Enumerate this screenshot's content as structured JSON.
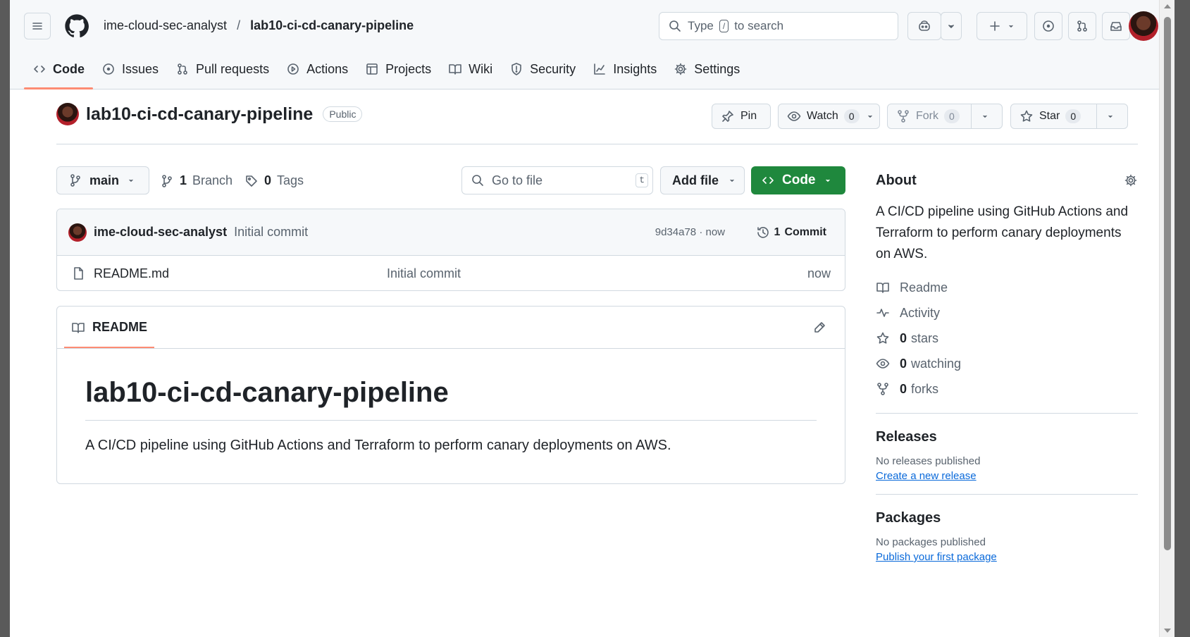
{
  "header": {
    "owner": "ime-cloud-sec-analyst",
    "separator": "/",
    "repo": "lab10-ci-cd-canary-pipeline",
    "search_text_before": "Type",
    "search_key": "/",
    "search_text_after": "to search"
  },
  "tabs": [
    {
      "label": "Code",
      "icon": "code-icon"
    },
    {
      "label": "Issues",
      "icon": "issue-icon"
    },
    {
      "label": "Pull requests",
      "icon": "pull-request-icon"
    },
    {
      "label": "Actions",
      "icon": "play-icon"
    },
    {
      "label": "Projects",
      "icon": "table-icon"
    },
    {
      "label": "Wiki",
      "icon": "book-icon"
    },
    {
      "label": "Security",
      "icon": "shield-icon"
    },
    {
      "label": "Insights",
      "icon": "graph-icon"
    },
    {
      "label": "Settings",
      "icon": "gear-icon"
    }
  ],
  "repo_head": {
    "name": "lab10-ci-cd-canary-pipeline",
    "visibility": "Public",
    "pin_label": "Pin",
    "watch_label": "Watch",
    "watch_count": "0",
    "fork_label": "Fork",
    "fork_count": "0",
    "star_label": "Star",
    "star_count": "0"
  },
  "file_nav": {
    "branch": "main",
    "branches_count": "1",
    "branches_label": "Branch",
    "tags_count": "0",
    "tags_label": "Tags",
    "goto_placeholder": "Go to file",
    "goto_key": "t",
    "add_file_label": "Add file",
    "code_label": "Code"
  },
  "latest_commit": {
    "author": "ime-cloud-sec-analyst",
    "message": "Initial commit",
    "sha_time": "9d34a78 · now",
    "commits_count": "1",
    "commits_label": "Commit"
  },
  "files": [
    {
      "name": "README.md",
      "message": "Initial commit",
      "time": "now"
    }
  ],
  "readme": {
    "tab_label": "README",
    "title": "lab10-ci-cd-canary-pipeline",
    "body": "A CI/CD pipeline using GitHub Actions and Terraform to perform canary deployments on AWS."
  },
  "about": {
    "heading": "About",
    "description": "A CI/CD pipeline using GitHub Actions and Terraform to perform canary deployments on AWS.",
    "readme_label": "Readme",
    "activity_label": "Activity",
    "stars_count": "0",
    "stars_label": "stars",
    "watching_count": "0",
    "watching_label": "watching",
    "forks_count": "0",
    "forks_label": "forks"
  },
  "releases": {
    "heading": "Releases",
    "empty_text": "No releases published",
    "link": "Create a new release"
  },
  "packages": {
    "heading": "Packages",
    "empty_text": "No packages published",
    "link": "Publish your first package"
  },
  "colors": {
    "accent_tab": "#fd8c73",
    "code_button": "#1f883d",
    "link": "#0969da"
  }
}
